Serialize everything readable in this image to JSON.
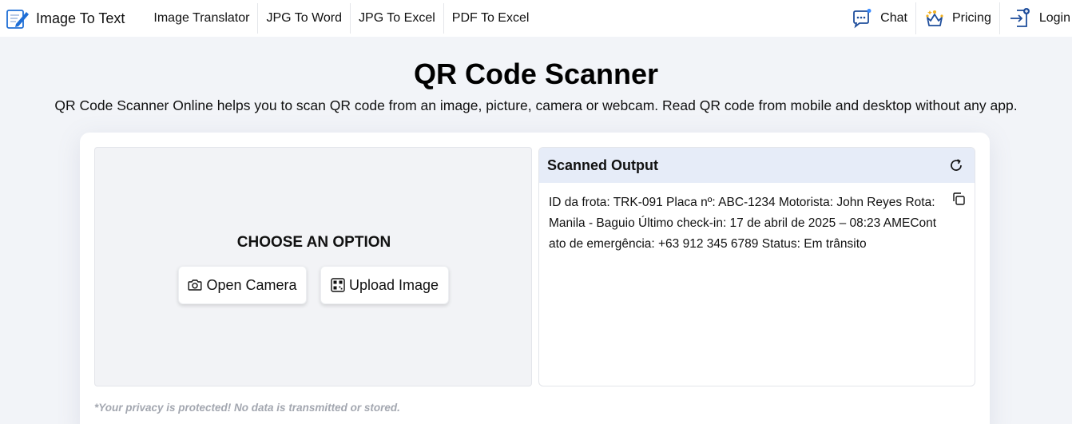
{
  "header": {
    "brand": "Image To Text",
    "nav": [
      "Image Translator",
      "JPG To Word",
      "JPG To Excel",
      "PDF To Excel"
    ],
    "chat_label": "Chat",
    "pricing_label": "Pricing",
    "login_label": "Login"
  },
  "main": {
    "title": "QR Code Scanner",
    "subtitle": "QR Code Scanner Online helps you to scan QR code from an image, picture, camera or webcam. Read QR code from mobile and desktop without any app."
  },
  "scanner": {
    "choose_label": "CHOOSE AN OPTION",
    "open_camera_label": "Open Camera",
    "upload_image_label": "Upload Image"
  },
  "output": {
    "title": "Scanned Output",
    "text": "ID da frota: TRK-091 Placa nº: ABC-1234 Motorista: John Reyes Rota: Manila - Baguio Último check-in: 17 de abril de 2025 – 08:23 AMEContato de emergência: +63 912 345 6789 Status: Em trânsito"
  },
  "privacy_note": "*Your privacy is protected! No data is transmitted or stored.",
  "colors": {
    "accent": "#1f6fd6",
    "output_header_bg": "#e6ecf8",
    "page_bg": "#f2f4f8"
  },
  "icons": {
    "brand": "edit-note-icon",
    "chat": "chat-bubble-icon",
    "pricing": "crown-icon",
    "login": "login-icon",
    "camera": "camera-icon",
    "upload": "qr-code-icon",
    "refresh": "refresh-icon",
    "copy": "copy-icon"
  }
}
